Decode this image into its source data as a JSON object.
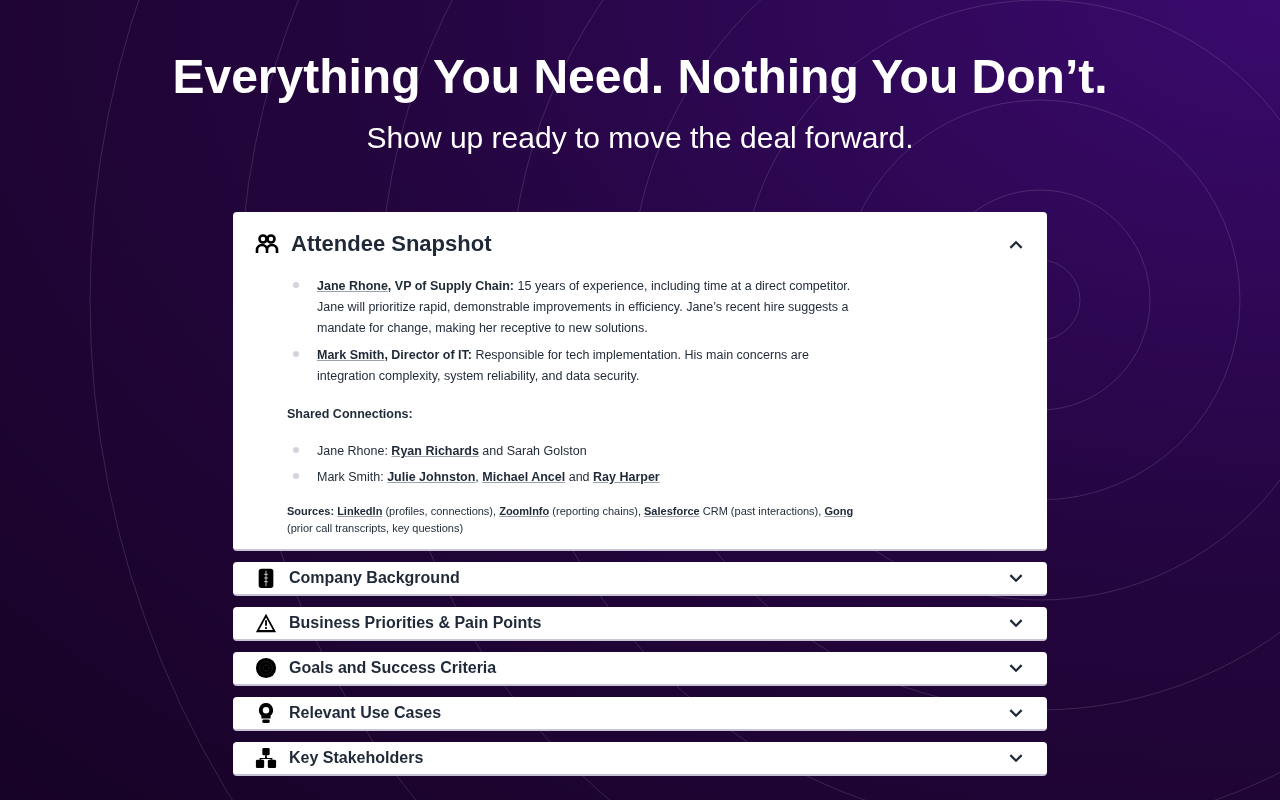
{
  "hero": {
    "title": "Everything You Need. Nothing You Don’t.",
    "subtitle": "Show up ready to move the deal forward."
  },
  "sections": [
    {
      "title": "Attendee Snapshot",
      "expanded": true,
      "attendees": [
        [
          {
            "kind": "link",
            "text": "Jane Rhone"
          },
          {
            "kind": "bold",
            "text": ", VP of Supply Chain:"
          },
          {
            "kind": "plain",
            "text": " 15 years of experience, including time at a direct competitor. Jane will prioritize rapid, demonstrable improvements in efficiency. Jane’s recent hire suggests a mandate for change, making her receptive to new solutions."
          }
        ],
        [
          {
            "kind": "link",
            "text": "Mark Smith"
          },
          {
            "kind": "bold",
            "text": ", Director of IT:"
          },
          {
            "kind": "plain",
            "text": " Responsible for tech implementation. His main concerns are integration complexity, system reliability, and data security."
          }
        ]
      ],
      "connections_heading": "Shared Connections:",
      "connections": [
        [
          {
            "kind": "plain",
            "text": "Jane Rhone: "
          },
          {
            "kind": "link",
            "text": "Ryan Richards"
          },
          {
            "kind": "plain",
            "text": " and Sarah Golston"
          }
        ],
        [
          {
            "kind": "plain",
            "text": "Mark Smith: "
          },
          {
            "kind": "link",
            "text": "Julie Johnston"
          },
          {
            "kind": "plain",
            "text": ", "
          },
          {
            "kind": "link",
            "text": "Michael Ancel"
          },
          {
            "kind": "plain",
            "text": " and "
          },
          {
            "kind": "link",
            "text": "Ray Harper"
          }
        ]
      ],
      "sources": [
        {
          "kind": "bold",
          "text": "Sources: "
        },
        {
          "kind": "link",
          "text": "LinkedIn"
        },
        {
          "kind": "plain",
          "text": " (profiles, connections), "
        },
        {
          "kind": "link",
          "text": "ZoomInfo"
        },
        {
          "kind": "plain",
          "text": " (reporting chains), "
        },
        {
          "kind": "link",
          "text": "Salesforce"
        },
        {
          "kind": "plain",
          "text": " CRM (past interactions), "
        },
        {
          "kind": "link",
          "text": "Gong"
        },
        {
          "kind": "plain",
          "text": " (prior call transcripts, key questions)"
        }
      ]
    },
    {
      "title": "Company Background",
      "expanded": false
    },
    {
      "title": "Business Priorities & Pain Points",
      "expanded": false
    },
    {
      "title": "Goals and Success Criteria",
      "expanded": false
    },
    {
      "title": "Relevant Use Cases",
      "expanded": false
    },
    {
      "title": "Key Stakeholders",
      "expanded": false
    }
  ]
}
